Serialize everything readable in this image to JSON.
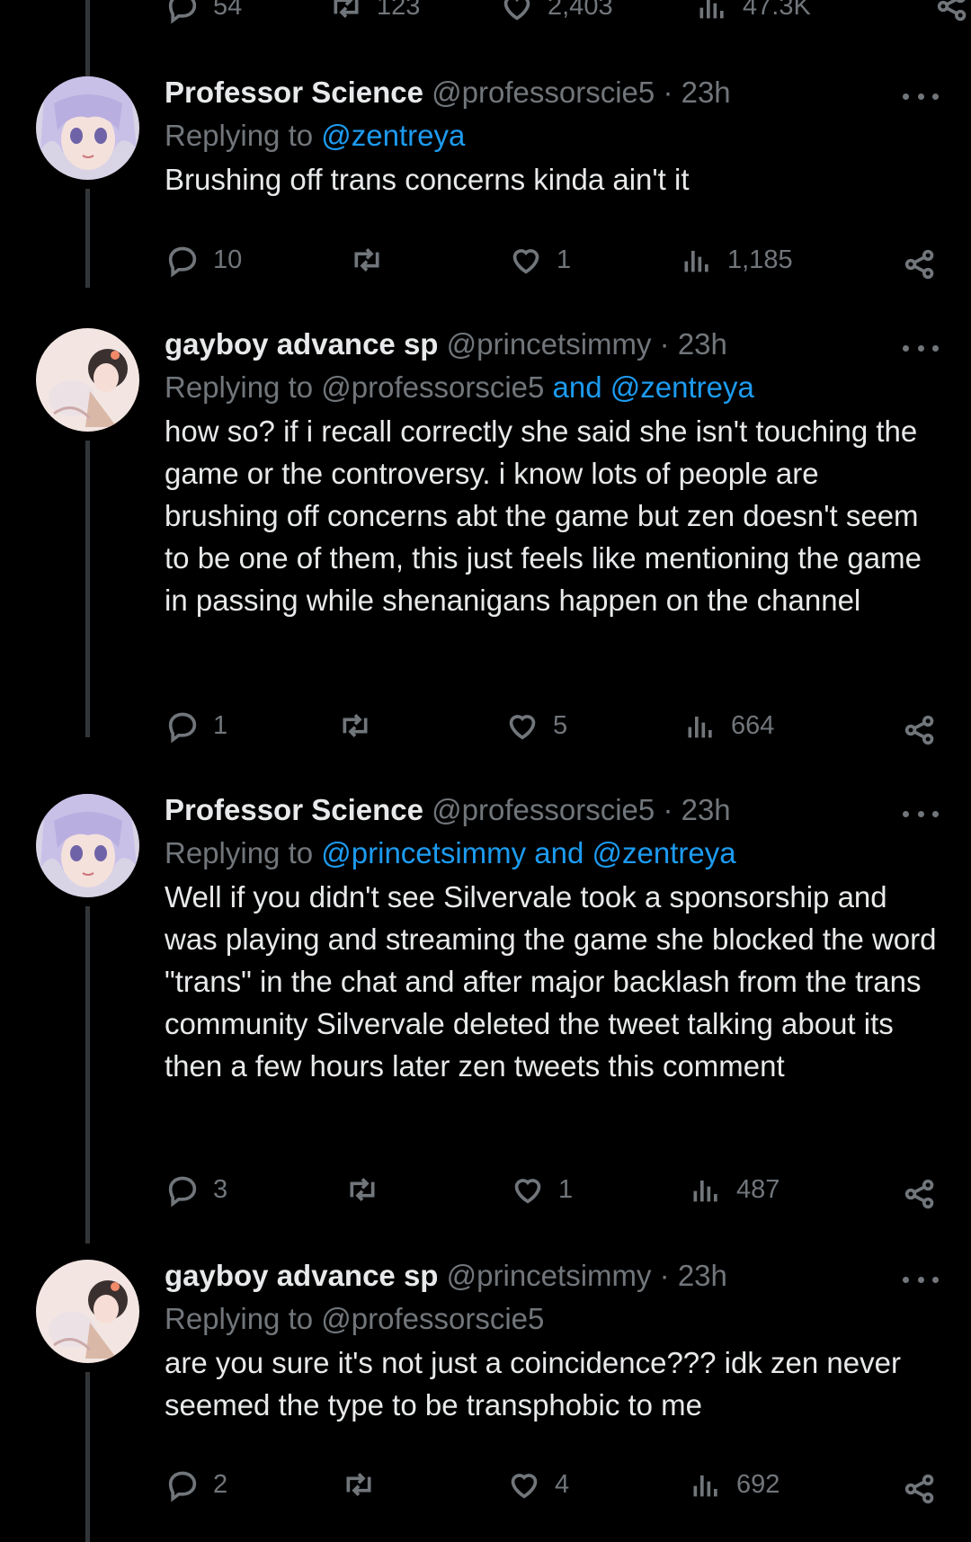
{
  "top_actions": {
    "replies": "54",
    "retweets": "123",
    "likes": "2,403",
    "views": "47.3K"
  },
  "tweets": [
    {
      "name": "Professor Science",
      "handle": "@professorscie5",
      "time": "· 23h",
      "replying_prefix": "Replying to ",
      "replying_plain": "",
      "replying_link": "@zentreya",
      "body": "Brushing off trans concerns kinda ain't it",
      "replies": "10",
      "retweets": "",
      "likes": "1",
      "views": "1,185"
    },
    {
      "name": "gayboy advance sp",
      "handle": "@princetsimmy",
      "time": "· 23h",
      "replying_prefix": "Replying to ",
      "replying_plain": "@professorscie5 ",
      "replying_link": "and @zentreya",
      "body": "how so? if i recall correctly she said she isn't touching the game or the controversy. i know lots of people are brushing off concerns abt the game but zen doesn't seem to be one of them, this just feels like mentioning the game in passing while shenanigans happen on the channel",
      "replies": "1",
      "retweets": "",
      "likes": "5",
      "views": "664"
    },
    {
      "name": "Professor Science",
      "handle": "@professorscie5",
      "time": "· 23h",
      "replying_prefix": "Replying to ",
      "replying_plain": "",
      "replying_link": "@princetsimmy and @zentreya",
      "body": "Well if you didn't see Silvervale took a sponsorship and was playing and streaming the game she blocked the word \"trans\" in the chat and after major backlash from the trans community Silvervale deleted the tweet talking about its then a few hours later zen tweets this comment",
      "replies": "3",
      "retweets": "",
      "likes": "1",
      "views": "487"
    },
    {
      "name": "gayboy advance sp",
      "handle": "@princetsimmy",
      "time": "· 23h",
      "replying_prefix": "Replying to ",
      "replying_plain": "@professorscie5",
      "replying_link": "",
      "body": "are you sure it's not just a coincidence??? idk zen never seemed the type to be transphobic to me",
      "replies": "2",
      "retweets": "",
      "likes": "4",
      "views": "692"
    }
  ],
  "icons": {
    "reply": "reply-bubble-icon",
    "retweet": "retweet-icon",
    "like": "heart-icon",
    "views": "views-bar-chart-icon",
    "share": "share-icon",
    "more": "more-dots-icon"
  },
  "colors": {
    "background": "#000000",
    "text": "#e7e9ea",
    "muted": "#71767b",
    "link": "#1d9bf0"
  }
}
